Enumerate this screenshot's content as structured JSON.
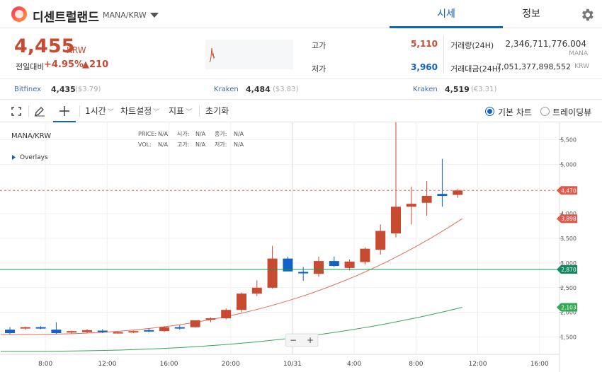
{
  "header": {
    "coin_name": "디센트럴랜드",
    "pair": "MANA/KRW",
    "tabs": [
      {
        "label": "시세",
        "active": true
      },
      {
        "label": "정보",
        "active": false
      }
    ]
  },
  "ticker": {
    "price": "4,455",
    "unit": "KRW",
    "change_label": "전일대비",
    "change_pct": "+4.95%",
    "change_amt": "▲210",
    "high_label": "고가",
    "high": "5,110",
    "low_label": "저가",
    "low": "3,960",
    "volume_label": "거래량(24H)",
    "volume": "2,346,711,776.004",
    "volume_unit": "MANA",
    "amount_label": "거래대금(24H)",
    "amount": "7,051,377,898,552",
    "amount_unit": "KRW"
  },
  "exchanges": [
    {
      "name": "Bitfinex",
      "price": "4,435",
      "usd": "($3.79)"
    },
    {
      "name": "Kraken",
      "price": "4,484",
      "usd": "($3.83)"
    },
    {
      "name": "Kraken",
      "price": "4,519",
      "usd": "(€3.31)"
    }
  ],
  "toolbar": {
    "interval": "1시간",
    "chart_settings": "차트설정",
    "indicators": "지표",
    "reset": "초기화",
    "basic_chart": "기본 차트",
    "tradingview": "트레이딩뷰"
  },
  "colors": {
    "up": "#c84a31",
    "down": "#1261c4",
    "accent": "#1261c4"
  },
  "chart_data": {
    "type": "candlestick",
    "symbol": "MANA/KRW",
    "overlays_label": "Overlays",
    "info": {
      "price_label": "PRICE:",
      "price": "N/A",
      "open_label": "시가:",
      "open": "N/A",
      "close_label": "종가:",
      "close": "N/A",
      "vol_label": "VOL:",
      "vol": "N/A",
      "high_label": "고가:",
      "high": "N/A",
      "low_label": "저가:",
      "low": "N/A"
    },
    "ylim": [
      1150,
      5850
    ],
    "y_ticks": [
      1500,
      2000,
      2500,
      3000,
      3500,
      4000,
      4500,
      5000,
      5500
    ],
    "y_tick_labels": [
      "1,500",
      "2,000",
      "2,500",
      "3,000",
      "3,500",
      "4,000",
      "4,500",
      "5,000",
      "5,500"
    ],
    "x_tick_labels": [
      "8:00",
      "12:00",
      "16:00",
      "20:00",
      "10/31",
      "4:00",
      "8:00",
      "12:00",
      "16:00"
    ],
    "x_tick_slots": [
      2.3,
      6.3,
      10.3,
      14.3,
      18.3,
      22.3,
      26.3,
      30.3,
      34.3
    ],
    "candles": [
      {
        "o": 1650,
        "h": 1700,
        "l": 1560,
        "c": 1580
      },
      {
        "o": 1680,
        "h": 1710,
        "l": 1650,
        "c": 1700
      },
      {
        "o": 1700,
        "h": 1720,
        "l": 1660,
        "c": 1680
      },
      {
        "o": 1650,
        "h": 1800,
        "l": 1560,
        "c": 1580
      },
      {
        "o": 1600,
        "h": 1630,
        "l": 1570,
        "c": 1620
      },
      {
        "o": 1600,
        "h": 1660,
        "l": 1580,
        "c": 1640
      },
      {
        "o": 1630,
        "h": 1660,
        "l": 1580,
        "c": 1600
      },
      {
        "o": 1590,
        "h": 1610,
        "l": 1570,
        "c": 1600
      },
      {
        "o": 1610,
        "h": 1630,
        "l": 1580,
        "c": 1620
      },
      {
        "o": 1640,
        "h": 1670,
        "l": 1600,
        "c": 1620
      },
      {
        "o": 1620,
        "h": 1720,
        "l": 1600,
        "c": 1700
      },
      {
        "o": 1700,
        "h": 1740,
        "l": 1650,
        "c": 1680
      },
      {
        "o": 1700,
        "h": 1830,
        "l": 1690,
        "c": 1840
      },
      {
        "o": 1850,
        "h": 1900,
        "l": 1800,
        "c": 1880
      },
      {
        "o": 1880,
        "h": 2080,
        "l": 1860,
        "c": 2050
      },
      {
        "o": 2050,
        "h": 2400,
        "l": 2000,
        "c": 2380
      },
      {
        "o": 2380,
        "h": 2650,
        "l": 2330,
        "c": 2500
      },
      {
        "o": 2500,
        "h": 3350,
        "l": 2480,
        "c": 3090
      },
      {
        "o": 3090,
        "h": 3130,
        "l": 2850,
        "c": 2830
      },
      {
        "o": 2820,
        "h": 2920,
        "l": 2640,
        "c": 2790
      },
      {
        "o": 2780,
        "h": 3130,
        "l": 2720,
        "c": 3040
      },
      {
        "o": 3040,
        "h": 3130,
        "l": 2920,
        "c": 2940
      },
      {
        "o": 2900,
        "h": 3070,
        "l": 2850,
        "c": 3030
      },
      {
        "o": 3020,
        "h": 3320,
        "l": 2970,
        "c": 3290
      },
      {
        "o": 3270,
        "h": 3780,
        "l": 3170,
        "c": 3650
      },
      {
        "o": 3600,
        "h": 5850,
        "l": 3520,
        "c": 4140
      },
      {
        "o": 4140,
        "h": 4550,
        "l": 3780,
        "c": 4200
      },
      {
        "o": 4220,
        "h": 4660,
        "l": 3960,
        "c": 4360
      },
      {
        "o": 4400,
        "h": 5110,
        "l": 4140,
        "c": 4360
      },
      {
        "o": 4380,
        "h": 4500,
        "l": 4320,
        "c": 4470
      }
    ],
    "ma_short": {
      "color": "#e06b5a",
      "label": "3,898",
      "from": 1550,
      "to": 3898
    },
    "ma_long": {
      "color": "#34a853",
      "label": "2,103",
      "from": 1210,
      "to": 2103
    },
    "current_price_label": "4,470",
    "current_price": 4470,
    "h_line_label": "2,870",
    "h_line": 2870,
    "zoom_minus": "−",
    "zoom_plus": "+"
  }
}
